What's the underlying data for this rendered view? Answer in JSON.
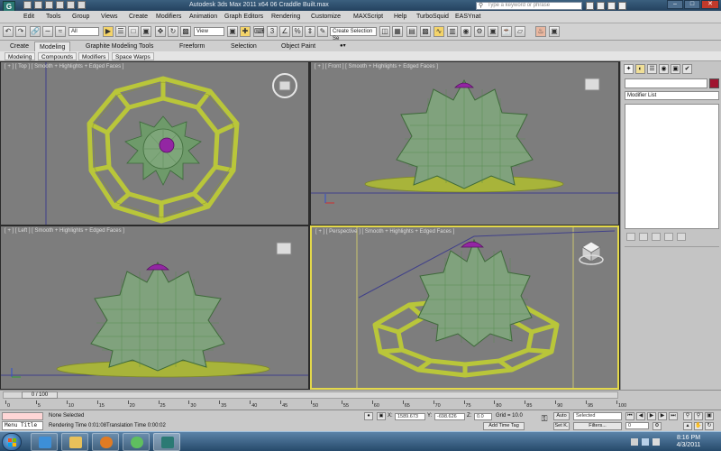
{
  "window": {
    "title": "Autodesk 3ds Max  2011 x64     06 Craddle Built.max",
    "search_placeholder": "Type a keyword or phrase",
    "controls": [
      "–",
      "□",
      "✕"
    ]
  },
  "menu": [
    "Edit",
    "Tools",
    "Group",
    "Views",
    "Create",
    "Modifiers",
    "Animation",
    "Graph Editors",
    "Rendering",
    "Customize",
    "MAXScript",
    "Help",
    "TurboSquid",
    "EASYnat"
  ],
  "toolbar": {
    "selection_filter": "All",
    "reference_coord": "View",
    "named_selection": "Create Selection Se"
  },
  "ribbon": {
    "tabs": [
      "Create",
      "Modeling",
      "Graphite Modeling Tools",
      "Freeform",
      "Selection",
      "Object Paint"
    ],
    "active_tab": "Modeling",
    "subtabs": [
      "Modeling",
      "Compounds",
      "Modifiers",
      "Space Warps"
    ]
  },
  "viewports": {
    "top": {
      "label": "[ + ] [ Top ] [ Smooth + Highlights + Edged Faces ]"
    },
    "front": {
      "label": "[ + ] [ Front ] [ Smooth + Highlights + Edged Faces ]"
    },
    "left": {
      "label": "[ + ] [ Left ] [ Smooth + Highlights + Edged Faces ]"
    },
    "perspective": {
      "label": "[ + ] [ Perspective ] [ Smooth + Highlights + Edged Faces ]"
    }
  },
  "command_panel": {
    "modifier_list": "Modifier List",
    "object_color": "#a0142f"
  },
  "timeline": {
    "slider": "0 / 100",
    "ticks": [
      "0",
      "5",
      "10",
      "15",
      "20",
      "25",
      "30",
      "35",
      "40",
      "45",
      "50",
      "55",
      "60",
      "65",
      "70",
      "75",
      "80",
      "85",
      "90",
      "95",
      "100"
    ]
  },
  "status": {
    "maxscript": "Menu Title",
    "selection": "None Selected",
    "render_time": "Rendering Time  0:01:08",
    "translation_time": "Translation Time  0:00:02",
    "x_value": "1589.673",
    "y_value": "-698.626",
    "z_value": "0.0",
    "grid": "Grid = 10.0",
    "add_time_tag": "Add Time Tag",
    "auto_key": "Auto",
    "set_key": "Set K.",
    "selected_dropdown": "Selected",
    "filters": "Filters...",
    "frame": "0"
  },
  "taskbar": {
    "time": "8:16 PM",
    "date": "4/3/2011"
  }
}
